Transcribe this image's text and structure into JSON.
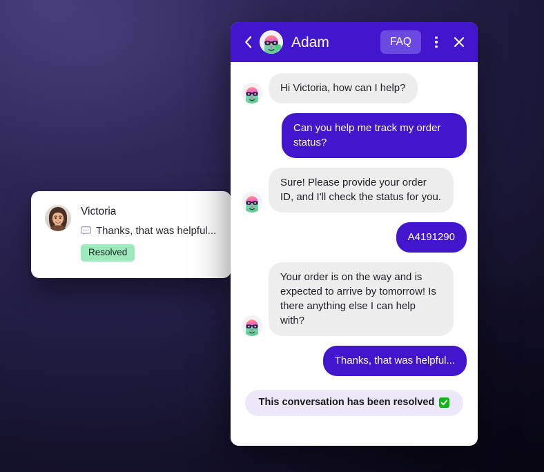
{
  "background": {
    "gradient_from": "#3b3266",
    "gradient_to": "#0d0b1c"
  },
  "victoria_card": {
    "name": "Victoria",
    "preview_icon": "chat-bubble-icon",
    "preview_text": "Thanks, that was helpful...",
    "status_badge": "Resolved",
    "status_color": "#9ce9be",
    "avatar_icon": "victoria-photo-avatar"
  },
  "chat": {
    "header": {
      "back_icon": "chevron-left-icon",
      "avatar_icon": "bot-avatar-icon",
      "title": "Adam",
      "faq_label": "FAQ",
      "faq_color": "#6a4ae0",
      "menu_icon": "kebab-menu-icon",
      "close_icon": "close-icon",
      "background_color": "#4116cc"
    },
    "messages": [
      {
        "sender": "bot",
        "text": "Hi Victoria, how can I help?",
        "show_avatar": true
      },
      {
        "sender": "user",
        "text": "Can you help me track my order status?",
        "show_avatar": false
      },
      {
        "sender": "bot",
        "text": "Sure! Please provide your order ID, and I'll check the status for you.",
        "show_avatar": true
      },
      {
        "sender": "user",
        "text": "A4191290",
        "show_avatar": false
      },
      {
        "sender": "bot",
        "text": "Your order is on the way and is expected to arrive by tomorrow! Is there anything else I can help with?",
        "show_avatar": true
      },
      {
        "sender": "user",
        "text": "Thanks, that was helpful...",
        "show_avatar": false
      }
    ],
    "resolved_banner": {
      "text": "This conversation has been resolved",
      "check_icon": "green-check-icon",
      "background_color": "#ece7f9"
    },
    "bubble_colors": {
      "bot": "#ededed",
      "user": "#4116cc"
    }
  }
}
